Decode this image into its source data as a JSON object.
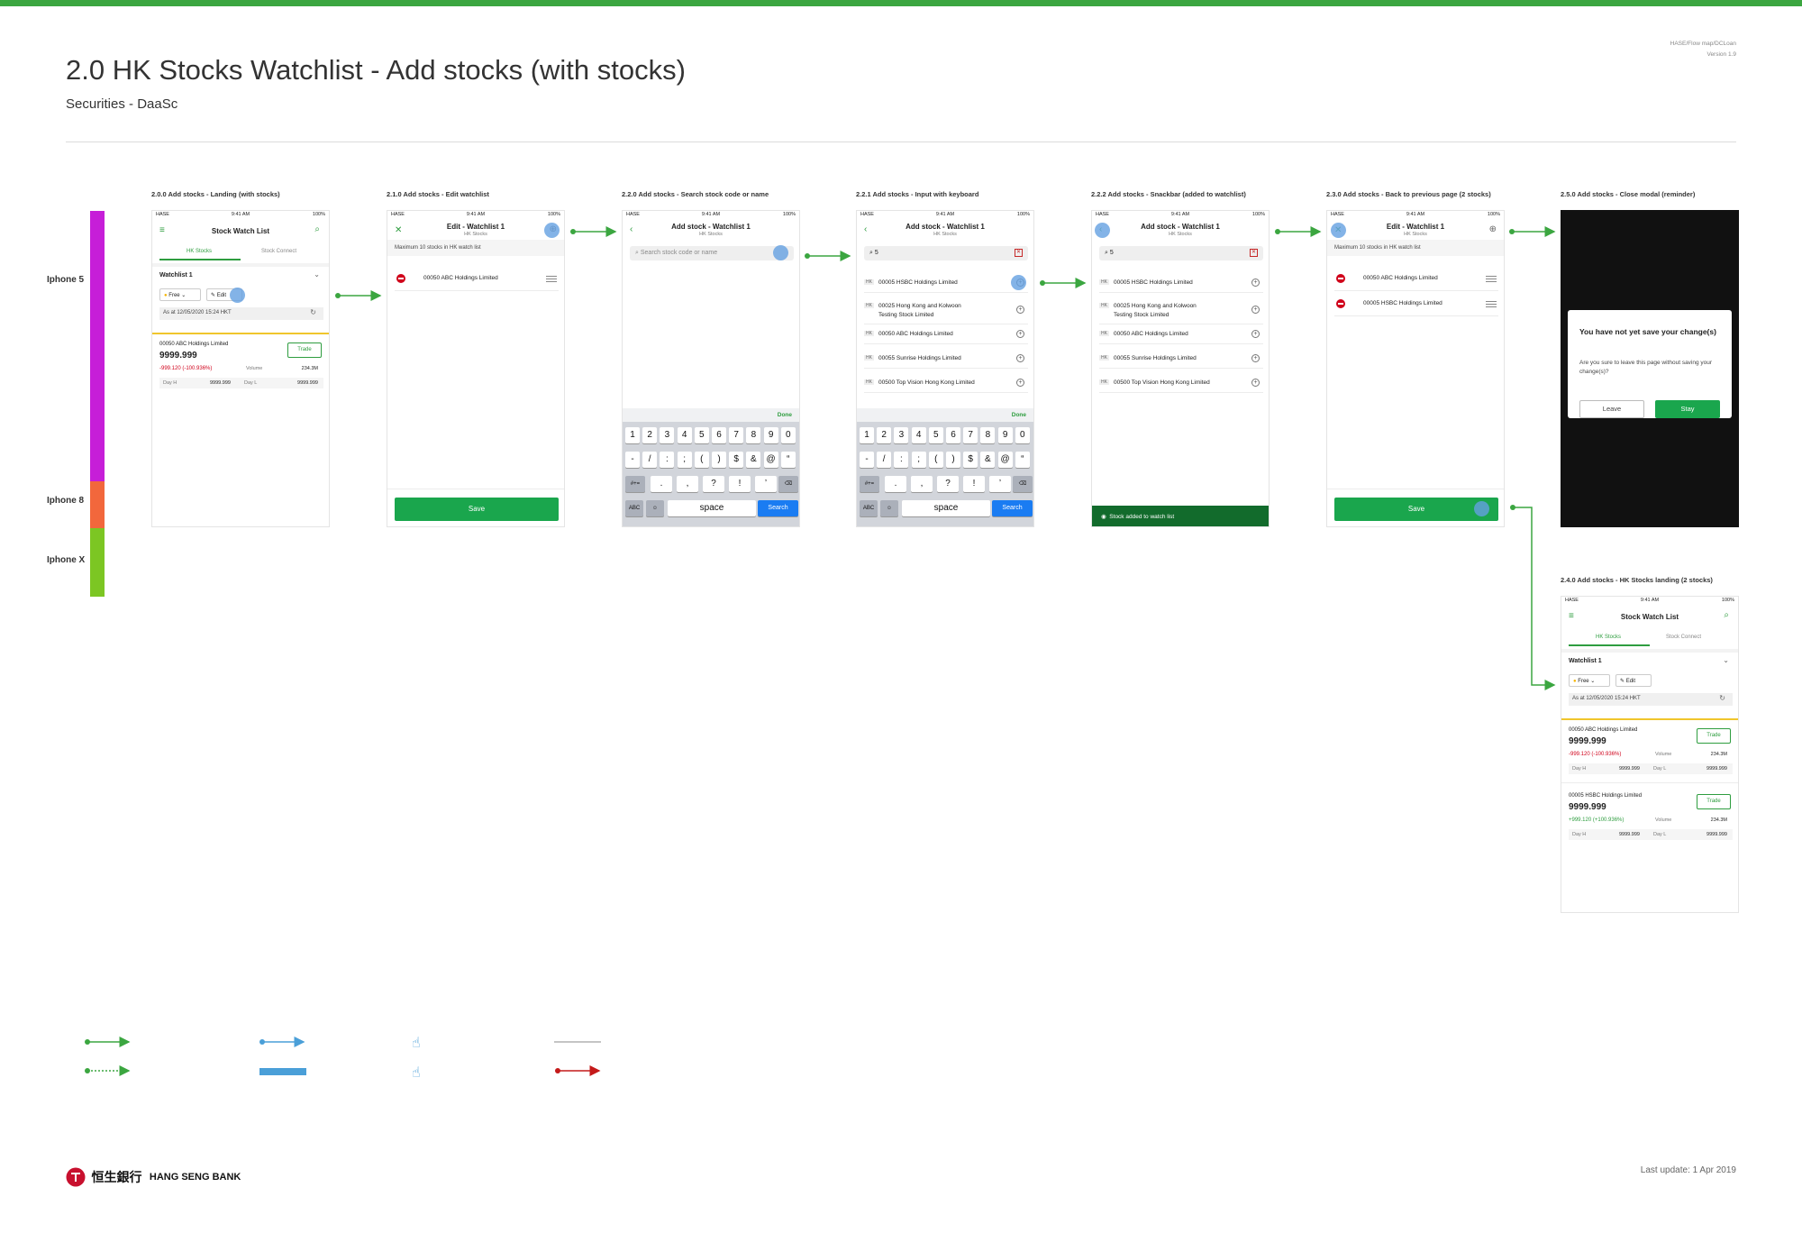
{
  "header": {
    "title": "2.0 HK Stocks Watchlist - Add stocks (with stocks)",
    "subtitle": "Securities - DaaSc",
    "meta_path": "HASE/Flow map/DCLoan",
    "meta_version": "Version 1.9"
  },
  "devices": [
    {
      "label": "Iphone 5",
      "color": "#c61ed8"
    },
    {
      "label": "Iphone 8",
      "color": "#f2673c"
    },
    {
      "label": "Iphone X",
      "color": "#7cc623"
    }
  ],
  "status_bar": {
    "carrier": "HASE",
    "time": "9:41 AM",
    "battery": "100%"
  },
  "screens": {
    "s200": {
      "label": "2.0.0 Add stocks - Landing (with stocks)",
      "title": "Stock Watch List",
      "tab1": "HK Stocks",
      "tab2": "Stock Connect",
      "watchlist": "Watchlist 1",
      "free": "Free",
      "edit": "Edit",
      "asat": "As at 12/05/2020  15:24 HKT",
      "stock_name": "00050  ABC Holdings Limited",
      "trade": "Trade",
      "price": "9999.999",
      "change": "-999.120  (-100.936%)",
      "volume_label": "Volume",
      "volume": "234.3M",
      "dayh_label": "Day H",
      "dayh": "9999.999",
      "dayl_label": "Day L",
      "dayl": "9999.999"
    },
    "s210": {
      "label": "2.1.0 Add stocks - Edit watchlist",
      "title": "Edit - Watchlist 1",
      "sub": "HK Stocks",
      "info": "Maximum 10 stocks in HK watch list",
      "item1": "00050  ABC Holdings Limited",
      "save": "Save"
    },
    "s220": {
      "label": "2.2.0 Add stocks - Search stock code or name",
      "title": "Add stock - Watchlist 1",
      "sub": "HK Stocks",
      "placeholder": "Search stock code or name",
      "done": "Done"
    },
    "s221": {
      "label": "2.2.1 Add stocks - Input with keyboard",
      "title": "Add stock - Watchlist 1",
      "sub": "HK Stocks",
      "query": "5",
      "done": "Done"
    },
    "s222": {
      "label": "2.2.2 Add stocks - Snackbar (added to watchlist)",
      "title": "Add stock - Watchlist 1",
      "sub": "HK Stocks",
      "query": "5",
      "snackbar": "Stock added to watch list"
    },
    "s230": {
      "label": "2.3.0 Add stocks - Back to previous page (2 stocks)",
      "title": "Edit - Watchlist 1",
      "sub": "HK Stocks",
      "info": "Maximum 10 stocks in HK watch list",
      "item1": "00050 ABC Holdings Limited",
      "item2": "00005  HSBC Holdings Limited",
      "save": "Save"
    },
    "s250": {
      "label": "2.5.0 Add stocks - Close modal (reminder)",
      "modal_title": "You have not yet save your change(s)",
      "modal_body": "Are you sure to leave this page without saving your change(s)?",
      "leave": "Leave",
      "stay": "Stay"
    },
    "s240": {
      "label": "2.4.0 Add stocks - HK Stocks landing (2 stocks)",
      "title": "Stock Watch List",
      "tab1": "HK Stocks",
      "tab2": "Stock Connect",
      "watchlist": "Watchlist 1",
      "free": "Free",
      "edit": "Edit",
      "asat": "As at 12/05/2020  15:24 HKT",
      "trade": "Trade",
      "stock1_name": "00050 ABC Holdings Limited",
      "stock1_price": "9999.999",
      "stock1_change": "-999.120  (-100.936%)",
      "stock2_name": "00005  HSBC Holdings Limited",
      "stock2_price": "9999.999",
      "stock2_change": "+999.120  (+100.936%)",
      "volume_label": "Volume",
      "volume": "234.3M",
      "dayh_label": "Day H",
      "dayh": "9999.999",
      "dayl_label": "Day L",
      "dayl": "9999.999"
    }
  },
  "search_results": [
    {
      "code": "00005",
      "name": "HSBC Holdings Limited"
    },
    {
      "code": "00025",
      "name": "Hong Kong and Kolwoon",
      "name2": "Testing Stock Limited"
    },
    {
      "code": "00050",
      "name": "ABC Holdings Limited"
    },
    {
      "code": "00055",
      "name": "Sunrise Holdings Limited"
    },
    {
      "code": "00500",
      "name": "Top Vision Hong Kong Limited"
    }
  ],
  "hk_tag": "HK",
  "keyboard": {
    "row1": [
      "1",
      "2",
      "3",
      "4",
      "5",
      "6",
      "7",
      "8",
      "9",
      "0"
    ],
    "row2": [
      "-",
      "/",
      ":",
      ";",
      "(",
      ")",
      "$",
      "&",
      "@",
      "“"
    ],
    "row3": [
      ".",
      ",",
      "?",
      "!",
      "’"
    ],
    "sym": "#+=",
    "abc": "ABC",
    "space": "space",
    "search": "Search"
  },
  "footer": {
    "bank_chinese": "恒生銀行",
    "bank_name": "HANG SENG BANK",
    "last_update": "Last update: 1 Apr 2019"
  },
  "colors": {
    "brand_green": "#3ba640",
    "button_green": "#1aa64d",
    "loss_red": "#d0021b",
    "tap_blue": "#64a0e1",
    "legend_red": "#c41a1a"
  }
}
